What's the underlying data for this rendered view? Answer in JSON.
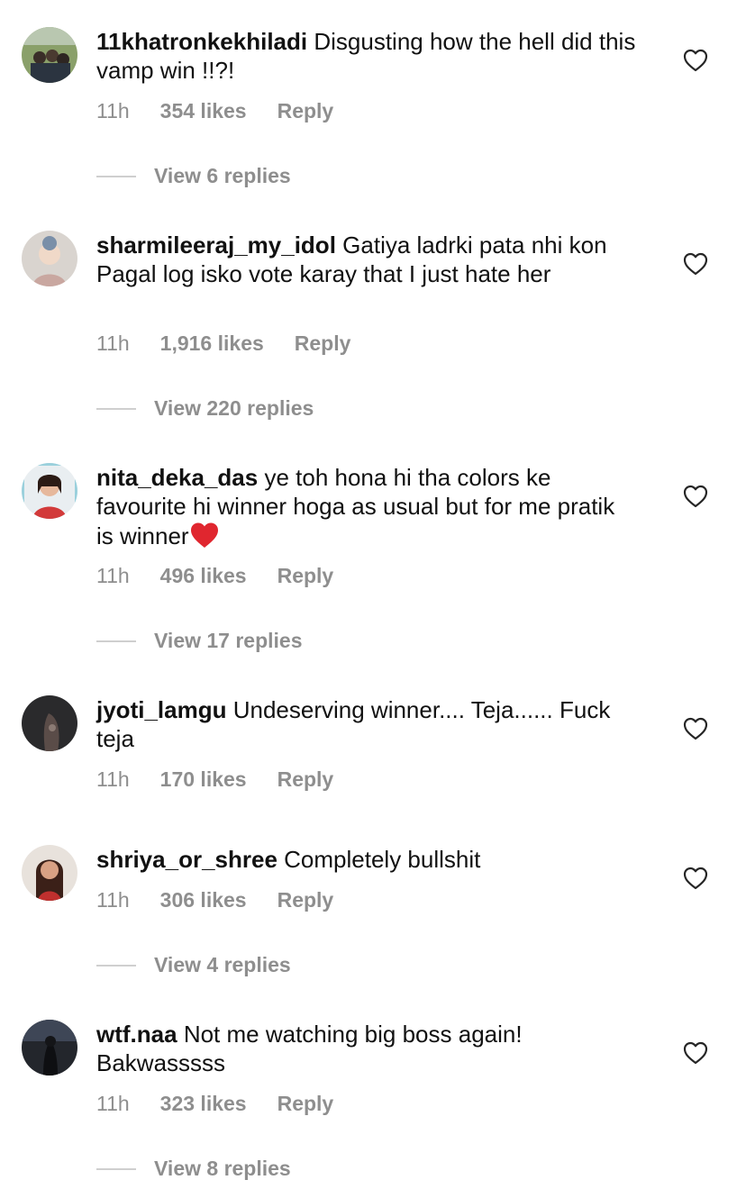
{
  "comments": [
    {
      "username": "11khatronkekhiladi",
      "text": "Disgusting how the hell did this vamp win !!?!",
      "time": "11h",
      "likes": "354 likes",
      "reply": "Reply",
      "view_replies": "View 6 replies"
    },
    {
      "username": "sharmileeraj_my_idol",
      "text": "Gatiya ladrki pata nhi kon Pagal log isko vote karay that I just hate her",
      "time": "11h",
      "likes": "1,916 likes",
      "reply": "Reply",
      "view_replies": "View 220 replies"
    },
    {
      "username": "nita_deka_das",
      "text": "ye toh hona hi tha colors ke favourite hi winner hoga as usual but for me pratik is winner",
      "emoji": "red-heart",
      "time": "11h",
      "likes": "496 likes",
      "reply": "Reply",
      "view_replies": "View 17 replies"
    },
    {
      "username": "jyoti_lamgu",
      "text": "Undeserving winner.... Teja...... Fuck teja",
      "time": "11h",
      "likes": "170 likes",
      "reply": "Reply",
      "view_replies": ""
    },
    {
      "username": "shriya_or_shree",
      "text": "Completely bullshit",
      "time": "11h",
      "likes": "306 likes",
      "reply": "Reply",
      "view_replies": "View 4 replies"
    },
    {
      "username": "wtf.naa",
      "text": "Not me watching big boss again! Bakwasssss",
      "time": "11h",
      "likes": "323 likes",
      "reply": "Reply",
      "view_replies": "View 8 replies"
    }
  ],
  "icons": {
    "like": "heart-outline-icon",
    "emoji": "red-heart"
  },
  "colors": {
    "meta_gray": "#8e8e8e",
    "emoji_red": "#e0262f"
  }
}
